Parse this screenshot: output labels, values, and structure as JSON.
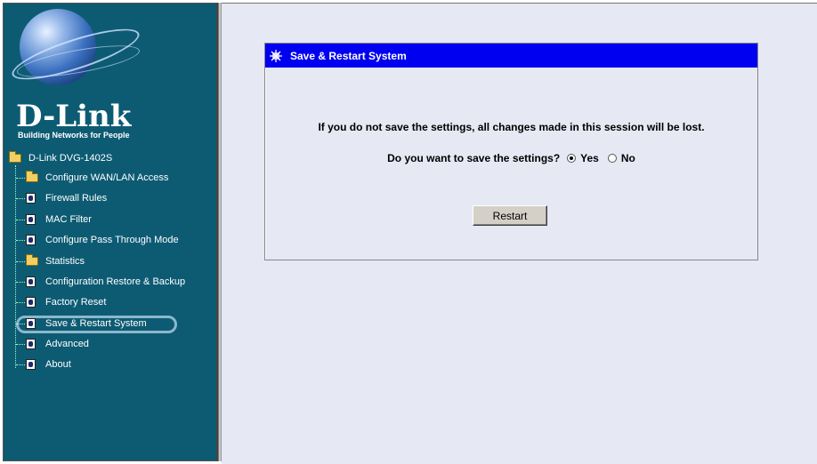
{
  "sidebar": {
    "logo": {
      "brand": "D-Link",
      "tagline": "Building Networks for People"
    },
    "root_label": "D-Link DVG-1402S",
    "items": [
      {
        "label": "Configure WAN/LAN Access",
        "icon": "folder-icon"
      },
      {
        "label": "Firewall Rules",
        "icon": "page-icon"
      },
      {
        "label": "MAC Filter",
        "icon": "page-icon"
      },
      {
        "label": "Configure Pass Through Mode",
        "icon": "page-icon"
      },
      {
        "label": "Statistics",
        "icon": "folder-icon"
      },
      {
        "label": "Configuration Restore & Backup",
        "icon": "page-icon"
      },
      {
        "label": "Factory Reset",
        "icon": "page-icon"
      },
      {
        "label": "Save & Restart System",
        "icon": "page-icon",
        "selected": true
      },
      {
        "label": "Advanced",
        "icon": "page-icon"
      },
      {
        "label": "About",
        "icon": "page-icon"
      }
    ]
  },
  "panel": {
    "title": "Save & Restart System",
    "message": "If you do not save the settings, all changes made in this session will be lost.",
    "question": "Do you want to save the settings?",
    "options": [
      {
        "label": "Yes",
        "checked": true
      },
      {
        "label": "No",
        "checked": false
      }
    ],
    "restart_label": "Restart"
  },
  "colors": {
    "sidebar_bg": "#0d5b73",
    "panel_header_bg": "#0000f0",
    "main_bg": "#e6e8f4",
    "highlight": "#8cb7cc"
  }
}
